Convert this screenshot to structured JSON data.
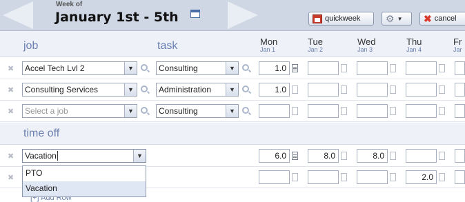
{
  "header": {
    "week_of": "Week of",
    "title": "January 1st - 5th",
    "buttons": {
      "quickweek": "quickweek",
      "cancel": "cancel"
    }
  },
  "columns": {
    "job": "job",
    "task": "task",
    "days": [
      {
        "name": "Mon",
        "date": "Jan 1"
      },
      {
        "name": "Tue",
        "date": "Jan 2"
      },
      {
        "name": "Wed",
        "date": "Jan 3"
      },
      {
        "name": "Thu",
        "date": "Jan 4"
      },
      {
        "name": "Fr",
        "date": "Jar"
      }
    ]
  },
  "rows": [
    {
      "job": "Accel Tech Lvl 2",
      "task": "Consulting",
      "hours": [
        "1.0",
        "",
        "",
        "",
        ""
      ]
    },
    {
      "job": "Consulting Services",
      "task": "Administration",
      "hours": [
        "1.0",
        "",
        "",
        "",
        ""
      ]
    },
    {
      "job": "Select a job",
      "task": "Consulting",
      "hours": [
        "",
        "",
        "",
        "",
        ""
      ]
    }
  ],
  "time_off": {
    "label": "time off",
    "rows": [
      {
        "type": "Vacation",
        "hours": [
          "6.0",
          "8.0",
          "8.0",
          "",
          ""
        ]
      },
      {
        "type": "",
        "hours": [
          "",
          "",
          "",
          "2.0",
          ""
        ]
      }
    ],
    "dropdown_options": [
      "PTO",
      "Vacation"
    ]
  },
  "add_row": "[+] Add Row"
}
